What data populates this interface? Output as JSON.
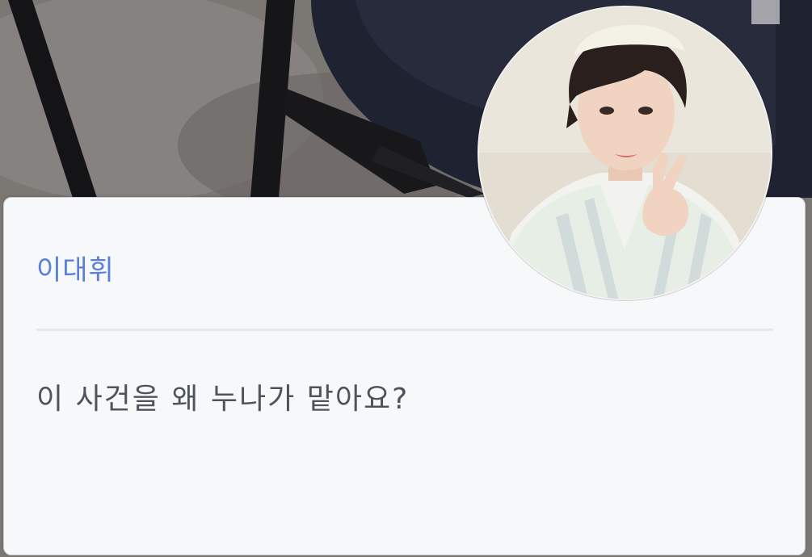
{
  "dialogue": {
    "speaker_name": "이대휘",
    "text": "이 사건을 왜 누나가 맡아요?"
  },
  "colors": {
    "speaker_name": "#5b7ed8",
    "text": "#4e545c",
    "card_background": "#f7f8fa",
    "divider": "#e6e8ec"
  },
  "icons": {
    "avatar": "character-portrait"
  }
}
